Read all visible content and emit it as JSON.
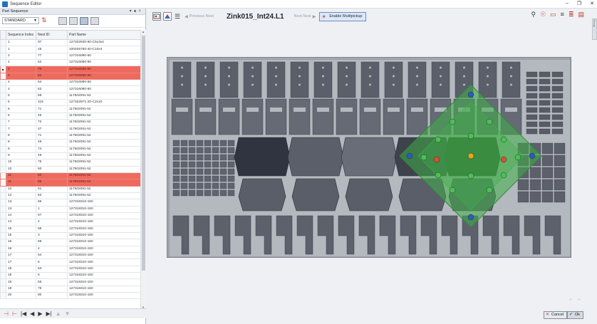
{
  "window": {
    "title": "Sequence Editor"
  },
  "panel": {
    "title": "Part Sequence",
    "strategy": "STANDARD"
  },
  "table": {
    "headers": [
      "Sequence Index",
      "Nest ID",
      "Part Name"
    ],
    "rows": [
      {
        "seq": "1",
        "nest": "97",
        "part": "127322930-60-C5x3x4",
        "sel": false
      },
      {
        "seq": "1",
        "nest": "45",
        "part": "100405760-40-C10x4",
        "sel": false
      },
      {
        "seq": "2",
        "nest": "77",
        "part": "127316080-50",
        "sel": false
      },
      {
        "seq": "2",
        "nest": "52",
        "part": "127316080-50",
        "sel": false
      },
      {
        "seq": "3",
        "nest": "76",
        "part": "127316080-50",
        "sel": true,
        "mark": true
      },
      {
        "seq": "3",
        "nest": "51",
        "part": "127316080-50",
        "sel": true
      },
      {
        "seq": "4",
        "nest": "64",
        "part": "127316080-50",
        "sel": false
      },
      {
        "seq": "4",
        "nest": "63",
        "part": "127316080-50",
        "sel": false
      },
      {
        "seq": "5",
        "nest": "59",
        "part": "117502091-52",
        "sel": false
      },
      {
        "seq": "5",
        "nest": "119",
        "part": "127322971-20-C2x10",
        "sel": false
      },
      {
        "seq": "6",
        "nest": "71",
        "part": "117502091-52",
        "sel": false
      },
      {
        "seq": "6",
        "nest": "46",
        "part": "117502091-52",
        "sel": false
      },
      {
        "seq": "7",
        "nest": "72",
        "part": "117502091-52",
        "sel": false
      },
      {
        "seq": "7",
        "nest": "47",
        "part": "117502091-52",
        "sel": false
      },
      {
        "seq": "8",
        "nest": "71",
        "part": "117502091-52",
        "sel": false
      },
      {
        "seq": "8",
        "nest": "48",
        "part": "117502091-52",
        "sel": false
      },
      {
        "seq": "9",
        "nest": "74",
        "part": "117502091-52",
        "sel": false
      },
      {
        "seq": "9",
        "nest": "49",
        "part": "117502091-52",
        "sel": false
      },
      {
        "seq": "10",
        "nest": "75",
        "part": "117502091-52",
        "sel": false
      },
      {
        "seq": "10",
        "nest": "50",
        "part": "117502091-52",
        "sel": false
      },
      {
        "seq": "11",
        "nest": "60",
        "part": "117502091-52",
        "sel": true
      },
      {
        "seq": "11",
        "nest": "86",
        "part": "117502091-52",
        "sel": true
      },
      {
        "seq": "12",
        "nest": "61",
        "part": "117502091-52",
        "sel": false
      },
      {
        "seq": "12",
        "nest": "62",
        "part": "117502091-52",
        "sel": false
      },
      {
        "seq": "13",
        "nest": "66",
        "part": "127318310-150",
        "sel": false
      },
      {
        "seq": "13",
        "nest": "1",
        "part": "127318310-150",
        "sel": false
      },
      {
        "seq": "14",
        "nest": "67",
        "part": "127318310-150",
        "sel": false
      },
      {
        "seq": "14",
        "nest": "2",
        "part": "127318310-150",
        "sel": false
      },
      {
        "seq": "15",
        "nest": "68",
        "part": "127318310-150",
        "sel": false
      },
      {
        "seq": "15",
        "nest": "3",
        "part": "127318310-150",
        "sel": false
      },
      {
        "seq": "16",
        "nest": "69",
        "part": "127318310-150",
        "sel": false
      },
      {
        "seq": "16",
        "nest": "4",
        "part": "127318310-150",
        "sel": false
      },
      {
        "seq": "17",
        "nest": "54",
        "part": "127318310-150",
        "sel": false
      },
      {
        "seq": "17",
        "nest": "5",
        "part": "127318310-150",
        "sel": false
      },
      {
        "seq": "18",
        "nest": "53",
        "part": "127318310-150",
        "sel": false
      },
      {
        "seq": "18",
        "nest": "6",
        "part": "127318310-150",
        "sel": false
      },
      {
        "seq": "19",
        "nest": "55",
        "part": "127318310-150",
        "sel": false
      },
      {
        "seq": "19",
        "nest": "79",
        "part": "127318310-150",
        "sel": false
      },
      {
        "seq": "20",
        "nest": "80",
        "part": "127318310-150",
        "sel": false
      }
    ]
  },
  "toolbar": {
    "prev_label": "Previous Nest",
    "nest_name": "Zink015_Int24.L1",
    "next_label": "Next Nest",
    "multipick_label": "Enable Multipickup"
  },
  "side_tab": "Group",
  "footer": {
    "cancel_label": "Cancel",
    "ok_label": "Ok"
  },
  "colors": {
    "selected_row": "#ef6a5e",
    "plate": "#acb0b8",
    "part": "#5b5f6a",
    "highlight": "#3fae49"
  }
}
